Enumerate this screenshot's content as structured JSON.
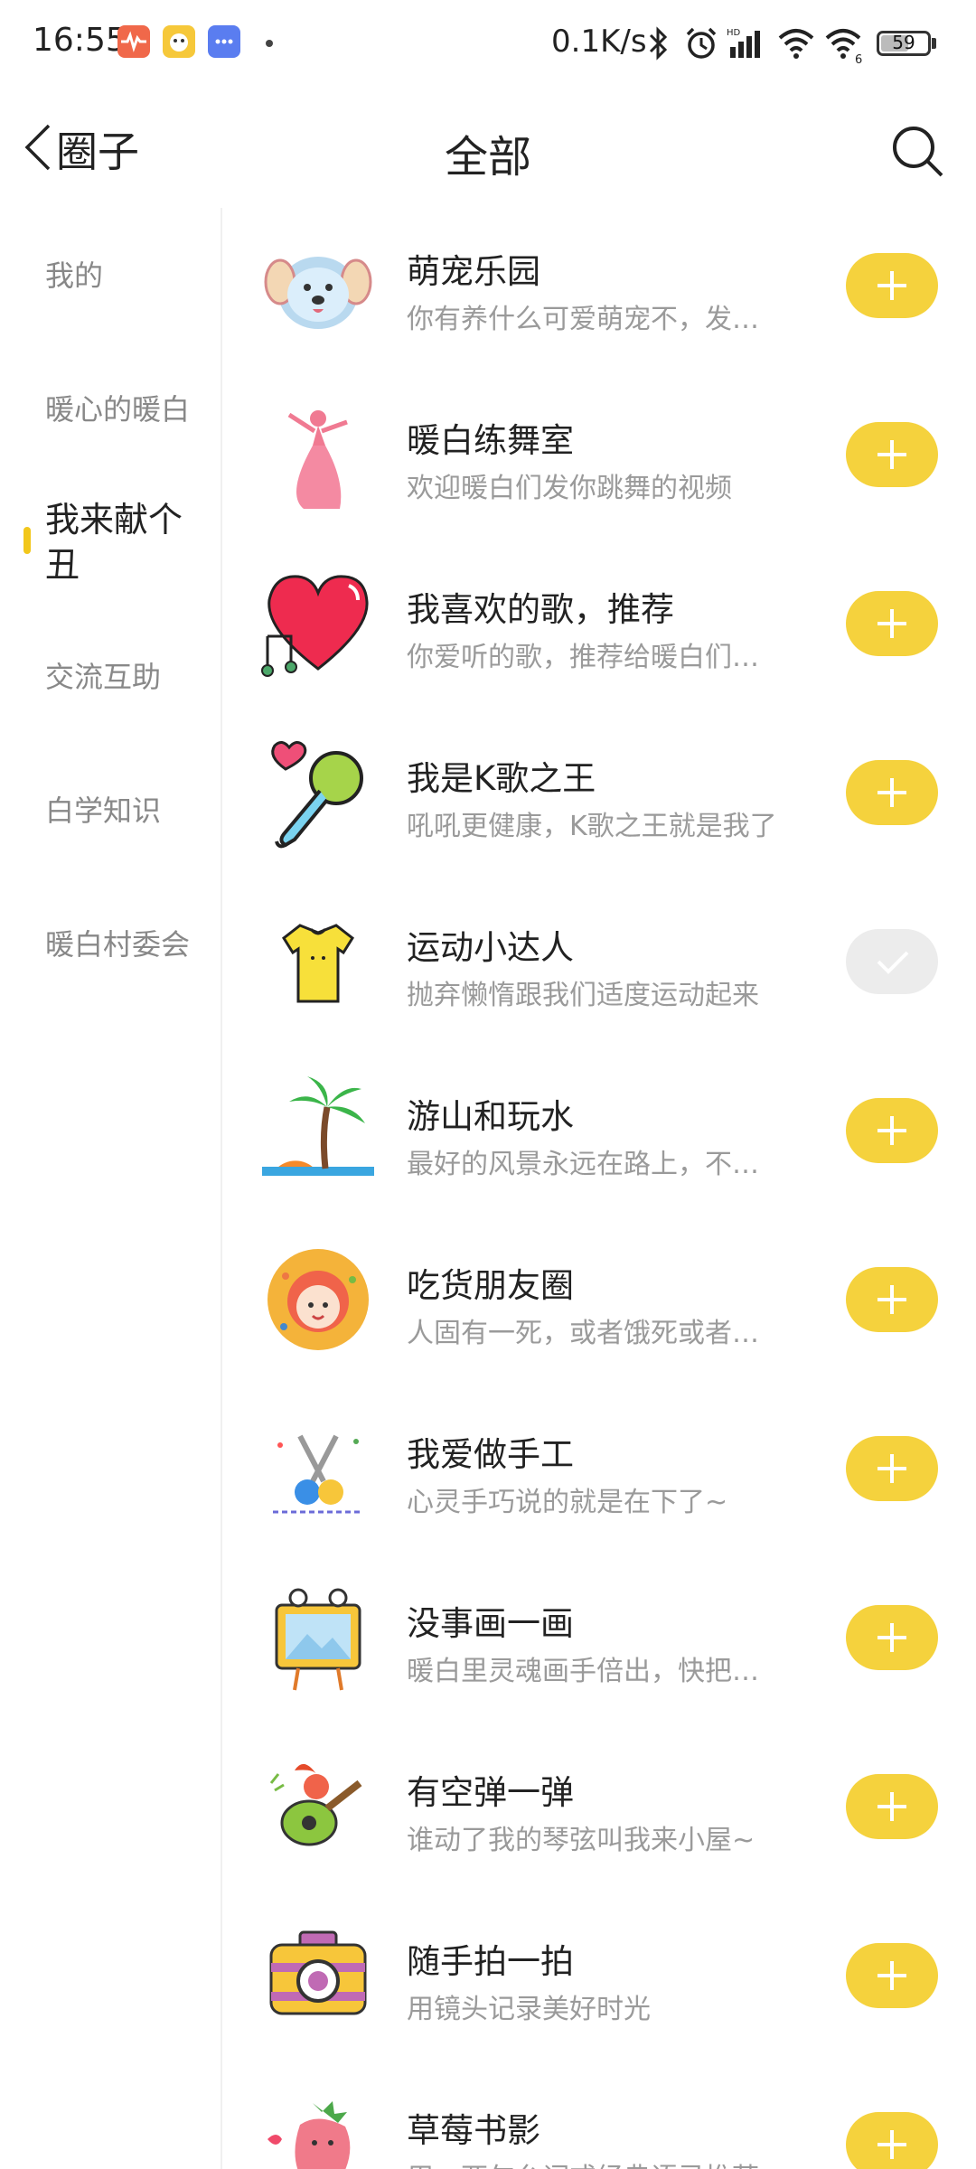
{
  "status_bar": {
    "time": "16:55",
    "net_speed": "0.1K/s",
    "battery_percent": "59",
    "battery_level": 0.59
  },
  "header": {
    "back_label": "圈子",
    "title": "全部"
  },
  "sidebar": {
    "items": [
      {
        "label": "我的",
        "active": false
      },
      {
        "label": "暖心的暖白",
        "active": false
      },
      {
        "label": "我来献个丑",
        "active": true
      },
      {
        "label": "交流互助",
        "active": false
      },
      {
        "label": "白学知识",
        "active": false
      },
      {
        "label": "暖白村委会",
        "active": false
      }
    ]
  },
  "circles": [
    {
      "title": "萌宠乐园",
      "desc": "你有养什么可爱萌宠不，发来看看吧",
      "icon": "dog-icon",
      "joined": false
    },
    {
      "title": "暖白练舞室",
      "desc": "欢迎暖白们发你跳舞的视频",
      "icon": "dancer-icon",
      "joined": false
    },
    {
      "title": "我喜欢的歌，推荐",
      "desc": "你爱听的歌，推荐给暖白们也听听",
      "icon": "heart-music-icon",
      "joined": false
    },
    {
      "title": "我是K歌之王",
      "desc": "吼吼更健康，K歌之王就是我了",
      "icon": "microphone-icon",
      "joined": false
    },
    {
      "title": "运动小达人",
      "desc": "抛弃懒惰跟我们适度运动起来",
      "icon": "tshirt-icon",
      "joined": true
    },
    {
      "title": "游山和玩水",
      "desc": "最好的风景永远在路上，不论远近",
      "icon": "palm-tree-icon",
      "joined": false
    },
    {
      "title": "吃货朋友圈",
      "desc": "人固有一死，或者饿死或者撑死",
      "icon": "foodie-icon",
      "joined": false
    },
    {
      "title": "我爱做手工",
      "desc": "心灵手巧说的就是在下了~",
      "icon": "scissors-icon",
      "joined": false
    },
    {
      "title": "没事画一画",
      "desc": "暖白里灵魂画手倍出，快把你的画作",
      "icon": "drawing-board-icon",
      "joined": false
    },
    {
      "title": "有空弹一弹",
      "desc": "谁动了我的琴弦叫我来小屋~",
      "icon": "guitar-icon",
      "joined": false
    },
    {
      "title": "随手拍一拍",
      "desc": "用镜头记录美好时光",
      "icon": "camera-icon",
      "joined": false
    },
    {
      "title": "草莓书影",
      "desc": "用一两句台词或经典语录推荐",
      "icon": "strawberry-icon",
      "joined": false
    }
  ],
  "colors": {
    "accent": "#f5d23d",
    "joined_bg": "#ececec",
    "muted_text": "#9a9a9a"
  }
}
